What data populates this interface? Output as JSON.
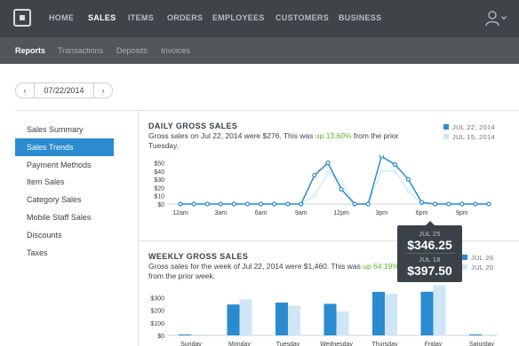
{
  "topnav": {
    "items": [
      "HOME",
      "SALES",
      "ITEMS",
      "ORDERS",
      "EMPLOYEES",
      "CUSTOMERS",
      "BUSINESS"
    ],
    "active_index": 1
  },
  "subnav": {
    "items": [
      "Reports",
      "Transactions",
      "Deposits",
      "Invoices"
    ],
    "active_index": 0
  },
  "datepicker": {
    "prev": "‹",
    "date": "07/22/2014",
    "next": "›"
  },
  "sidebar": {
    "items": [
      "Sales Summary",
      "Sales Trends",
      "Payment Methods",
      "Item Sales",
      "Category Sales",
      "Mobile Staff Sales",
      "Discounts",
      "Taxes"
    ],
    "active_index": 1
  },
  "daily": {
    "title": "DAILY GROSS SALES",
    "desc_pre": "Gross sales on Jul 22, 2014 were $276. This was ",
    "desc_up": "up 13.60%",
    "desc_post": " from the prior Tuesday.",
    "legend": [
      "JUL 22, 2014",
      "JUL 15, 2014"
    ]
  },
  "weekly": {
    "title": "WEEKLY GROSS SALES",
    "desc_pre": "Gross sales for the week of Jul 22, 2014 were $1,460. This was ",
    "desc_up": "up 64.19%",
    "desc_post": " from the prior week.",
    "legend": [
      "JUL 26",
      "JUL 20"
    ]
  },
  "tooltip": {
    "date1": "JUL 25",
    "value1": "$346.25",
    "date2": "JUL 18",
    "value2": "$397.50"
  },
  "colors": {
    "primary": "#2b8bd0",
    "secondary": "#cfe6f6",
    "up": "#59b52e",
    "nav_bg": "#3e4448",
    "subnav_bg": "#505659"
  },
  "chart_data": [
    {
      "type": "line",
      "y_ticks": [
        "$50",
        "$40",
        "$30",
        "$20",
        "$10",
        "$0"
      ],
      "x_ticks": [
        "12am",
        "3am",
        "6am",
        "9am",
        "12pm",
        "3pm",
        "6pm",
        "9pm"
      ],
      "ylim": [
        0,
        55
      ],
      "x": [
        0,
        1,
        2,
        3,
        4,
        5,
        6,
        7,
        8,
        9,
        10,
        11,
        12,
        13,
        14,
        15,
        16,
        17,
        18,
        19,
        20,
        21,
        22,
        23
      ],
      "series": [
        {
          "name": "JUL 22, 2014",
          "values": [
            0,
            0,
            0,
            0,
            0,
            0,
            0,
            0,
            0,
            0,
            35,
            50,
            18,
            0,
            0,
            58,
            48,
            30,
            2,
            0,
            0,
            0,
            0,
            0
          ]
        },
        {
          "name": "JUL 15, 2014",
          "values": [
            0,
            0,
            0,
            0,
            0,
            0,
            0,
            0,
            0,
            0,
            10,
            38,
            28,
            0,
            0,
            40,
            40,
            16,
            0,
            0,
            0,
            0,
            0,
            0
          ]
        }
      ]
    },
    {
      "type": "bar",
      "y_ticks": [
        "$300",
        "$200",
        "$100",
        "$0"
      ],
      "categories": [
        "Sunday",
        "Monday",
        "Tuesday",
        "Wednesday",
        "Thursday",
        "Friday",
        "Saturday"
      ],
      "ylim": [
        0,
        380
      ],
      "series": [
        {
          "name": "JUL 26",
          "values": [
            0,
            245,
            260,
            250,
            345,
            346.25,
            0
          ]
        },
        {
          "name": "JUL 20",
          "values": [
            0,
            285,
            235,
            190,
            330,
            397.5,
            0
          ]
        }
      ]
    }
  ]
}
